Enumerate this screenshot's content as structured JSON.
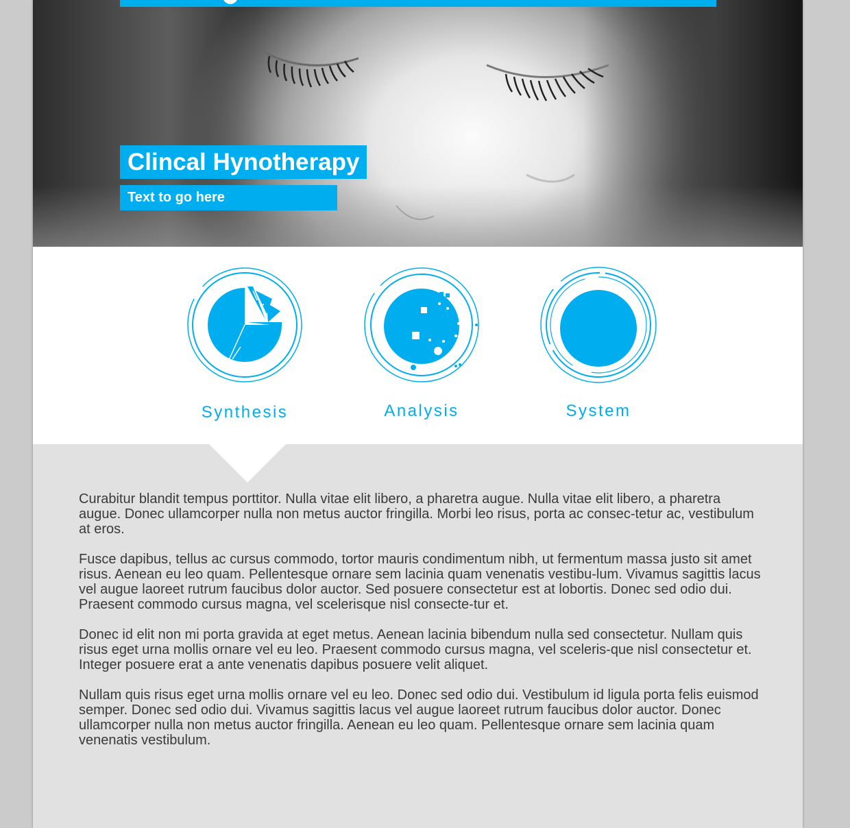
{
  "hero": {
    "title": "Clincal Hynotherapy",
    "subtitle": "Text to go here"
  },
  "features": [
    {
      "label": "Synthesis",
      "icon": "pie-chart-icon"
    },
    {
      "label": "Analysis",
      "icon": "scatter-dots-icon"
    },
    {
      "label": "System",
      "icon": "solid-circle-icon"
    }
  ],
  "body": {
    "paragraphs": [
      "Curabitur blandit tempus porttitor. Nulla vitae elit libero, a pharetra augue. Nulla vitae elit libero, a pharetra augue. Donec ullamcorper nulla non metus auctor fringilla. Morbi leo risus, porta ac consec-tetur ac, vestibulum at eros.",
      "Fusce dapibus, tellus ac cursus commodo, tortor mauris condimentum nibh, ut fermentum massa justo sit amet risus. Aenean eu leo quam. Pellentesque ornare sem lacinia quam venenatis vestibu-lum. Vivamus sagittis lacus vel augue laoreet rutrum faucibus dolor auctor. Sed posuere consectetur est at lobortis. Donec sed odio dui. Praesent commodo cursus magna, vel scelerisque nisl consecte-tur et.",
      "Donec id elit non mi porta gravida at eget metus. Aenean lacinia bibendum nulla sed consectetur. Nullam quis risus eget urna mollis ornare vel eu leo. Praesent commodo cursus magna, vel sceleris-que nisl consectetur et. Integer posuere erat a ante venenatis dapibus posuere velit aliquet.",
      "Nullam quis risus eget urna mollis ornare vel eu leo. Donec sed odio dui. Vestibulum id ligula porta felis euismod semper. Donec sed odio dui. Vivamus sagittis lacus vel augue laoreet rutrum faucibus dolor auctor. Donec ullamcorper nulla non metus auctor fringilla. Aenean eu leo quam. Pellentesque ornare sem lacinia quam venenatis vestibulum."
    ]
  },
  "colors": {
    "accent": "#00aeef",
    "panel": "#e1e1e1",
    "text": "#3a3a3a"
  }
}
